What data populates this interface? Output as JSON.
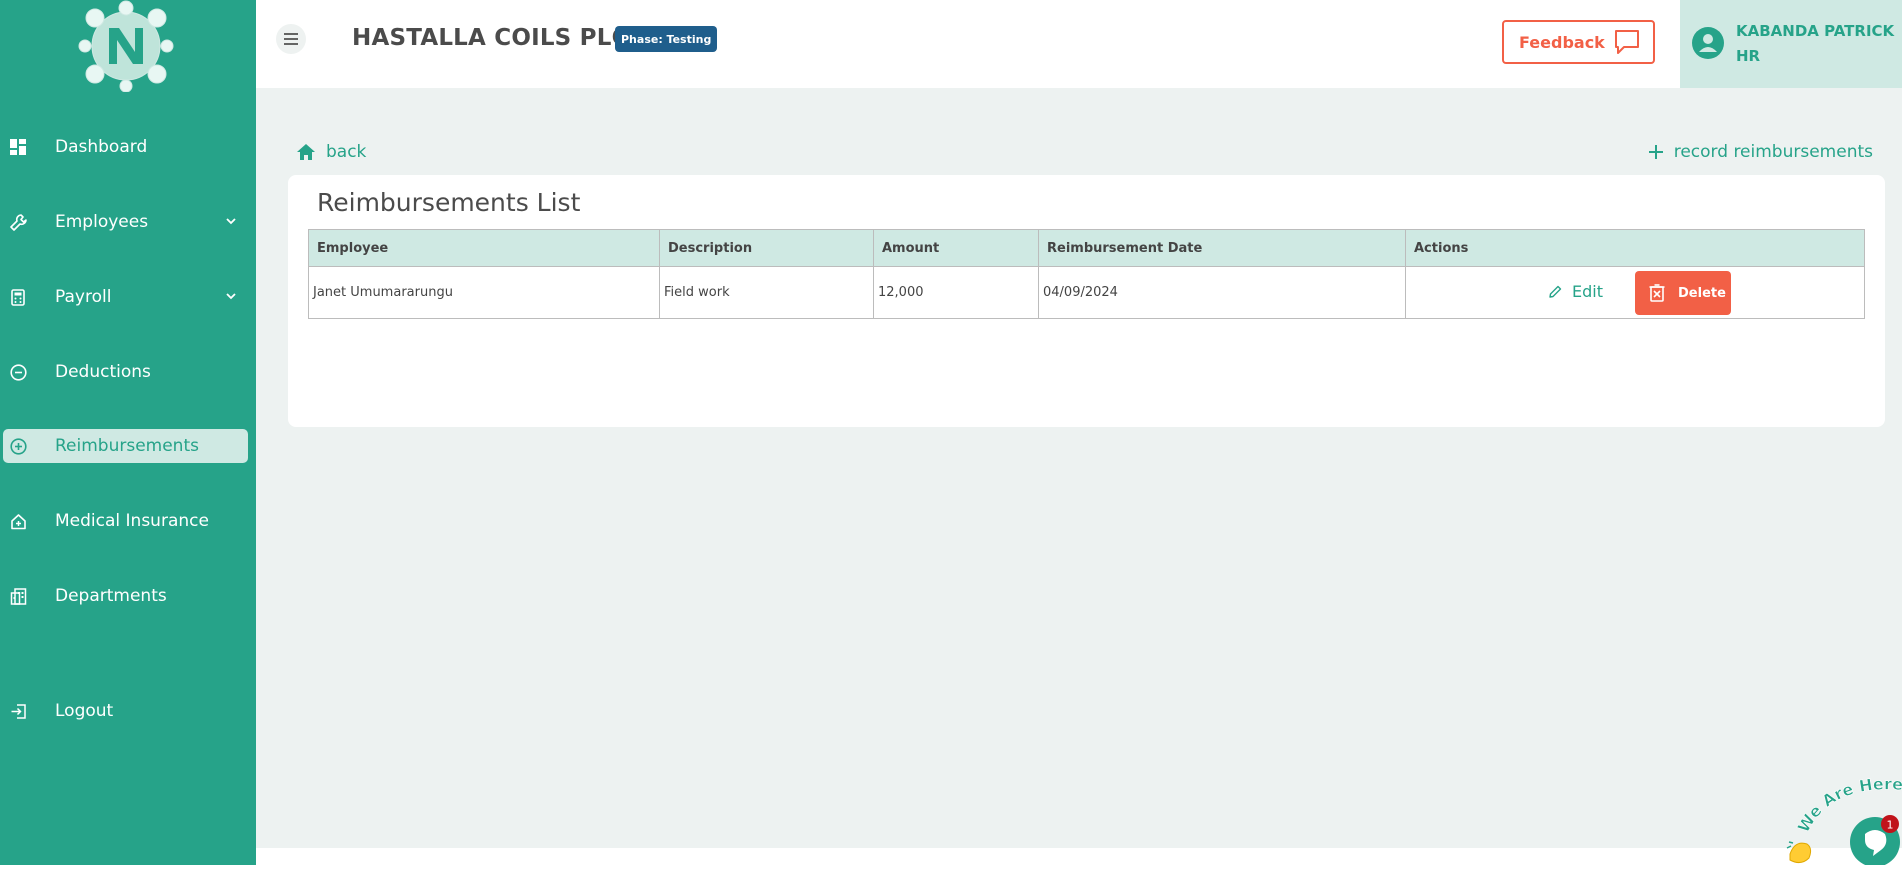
{
  "sidebar": {
    "items": [
      {
        "label": "Dashboard",
        "icon": "grid-icon"
      },
      {
        "label": "Employees",
        "icon": "wrench-icon"
      },
      {
        "label": "Payroll",
        "icon": "calculator-icon"
      },
      {
        "label": "Deductions",
        "icon": "minus-circle-icon"
      },
      {
        "label": "Reimbursements",
        "icon": "plus-circle-icon",
        "active": true
      },
      {
        "label": "Medical Insurance",
        "icon": "home-plus-icon"
      },
      {
        "label": "Departments",
        "icon": "building-icon"
      },
      {
        "label": "Logout",
        "icon": "logout-icon"
      }
    ]
  },
  "header": {
    "company": "HASTALLA COILS PLC",
    "phase": "Phase: Testing",
    "feedback_label": "Feedback",
    "user_name": "KABANDA PATRICK",
    "user_role": "HR"
  },
  "main": {
    "back_label": "back",
    "record_label": "record reimbursements",
    "title": "Reimbursements List",
    "columns": [
      "Employee",
      "Description",
      "Amount",
      "Reimbursement Date",
      "Actions"
    ],
    "rows": [
      {
        "employee": "Janet Umumararungu",
        "description": "Field work",
        "amount": "12,000",
        "date": "04/09/2024"
      }
    ],
    "edit_label": "Edit",
    "delete_label": "Delete"
  },
  "chat": {
    "badge": "1",
    "tagline": "We Are Here!"
  },
  "colors": {
    "brand": "#26a389",
    "accent": "#f26046",
    "active_bg": "#cfe9e3",
    "phase_badge": "#1f5e8c"
  }
}
